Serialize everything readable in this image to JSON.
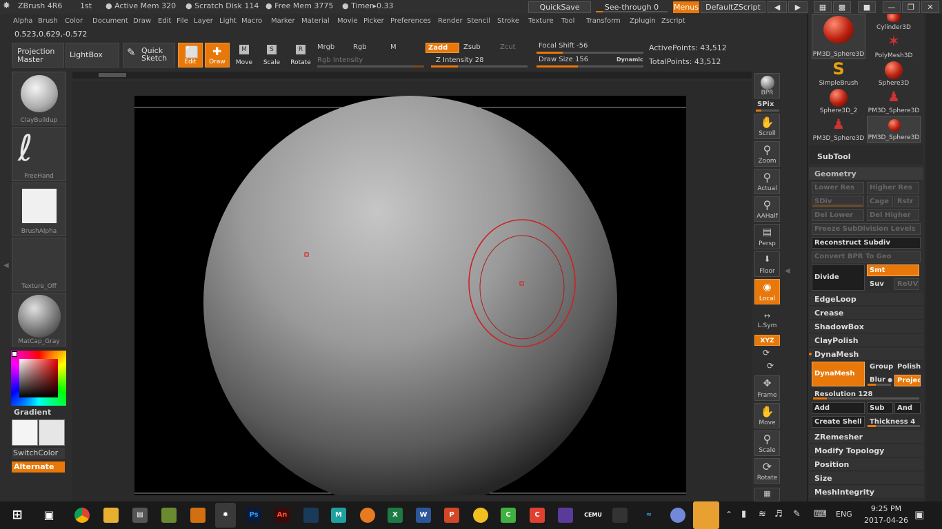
{
  "titlebar": {
    "app": "ZBrush 4R6",
    "doc": "1st",
    "active_mem": "● Active Mem 320",
    "scratch": "● Scratch Disk 114",
    "free_mem": "● Free Mem 3775",
    "timer": "● Timer▸0.33",
    "quicksave": "QuickSave",
    "see_through": "See-through  0",
    "menus": "Menus",
    "zscript": "DefaultZScript"
  },
  "menubar": [
    "Alpha",
    "Brush",
    "Color",
    "Document",
    "Draw",
    "Edit",
    "File",
    "Layer",
    "Light",
    "Macro",
    "Marker",
    "Material",
    "Movie",
    "Picker",
    "Preferences",
    "Render",
    "Stencil",
    "Stroke",
    "Texture",
    "Tool",
    "Transform",
    "Zplugin",
    "Zscript"
  ],
  "coords": "0.523,0.629,-0.572",
  "toolbar": {
    "projection_master": "Projection Master",
    "lightbox": "LightBox",
    "quick_sketch": "Quick Sketch",
    "edit": "Edit",
    "draw": "Draw",
    "move": "Move",
    "scale": "Scale",
    "rotate": "Rotate",
    "mrgb": "Mrgb",
    "rgb": "Rgb",
    "m": "M",
    "zadd": "Zadd",
    "zsub": "Zsub",
    "zcut": "Zcut",
    "rgb_intensity": "Rgb Intensity",
    "z_intensity": "Z Intensity 28",
    "focal_shift": "Focal Shift -56",
    "draw_size": "Draw Size 156",
    "dynamic": "Dynamic",
    "active_points": "ActivePoints: 43,512",
    "total_points": "TotalPoints: 43,512",
    "z_intensity_value": 28,
    "draw_size_value": 156,
    "focal_shift_value": -56
  },
  "left_panel": {
    "brush": "ClayBuildup",
    "stroke": "FreeHand",
    "alpha": "BrushAlpha",
    "texture": "Texture_Off",
    "material": "MatCap_Gray",
    "gradient": "Gradient",
    "switchcolor": "SwitchColor",
    "alternate": "Alternate"
  },
  "right_shelf": {
    "bpr": "BPR",
    "spix": "SPix",
    "scroll": "Scroll",
    "zoom": "Zoom",
    "actual": "Actual",
    "aahalf": "AAHalf",
    "persp": "Persp",
    "floor": "Floor",
    "local": "Local",
    "lsym": "L.Sym",
    "xyz": "XYZ",
    "frame": "Frame",
    "move": "Move",
    "scale": "Scale",
    "rotate": "Rotate",
    "polyf": "PolyF"
  },
  "tools": [
    {
      "name": "PM3D_Sphere3D"
    },
    {
      "name": "Cylinder3D"
    },
    {
      "name": "PolyMesh3D"
    },
    {
      "name": "SimpleBrush"
    },
    {
      "name": "Sphere3D"
    },
    {
      "name": "Sphere3D_2"
    },
    {
      "name": "PM3D_Sphere3D"
    },
    {
      "name": "PM3D_Sphere3D"
    },
    {
      "name": "PM3D_Sphere3D"
    }
  ],
  "subtool": "SubTool",
  "geometry": {
    "title": "Geometry",
    "lower_res": "Lower Res",
    "higher_res": "Higher Res",
    "sdiv": "SDiv",
    "cage": "Cage",
    "rstr": "Rstr",
    "del_lower": "Del Lower",
    "del_higher": "Del Higher",
    "freeze": "Freeze SubDivision Levels",
    "reconstruct": "Reconstruct Subdiv",
    "convert_bpr": "Convert BPR To Geo",
    "divide": "Divide",
    "smt": "Smt",
    "suv": "Suv",
    "reuv": "ReUV",
    "edgeloop": "EdgeLoop",
    "crease": "Crease",
    "shadowbox": "ShadowBox",
    "claypolish": "ClayPolish",
    "dynamesh_header": "DynaMesh",
    "dynamesh_btn": "DynaMesh",
    "group": "Group",
    "polish": "Polish",
    "blur": "Blur",
    "project": "Project",
    "resolution": "Resolution 128",
    "add": "Add",
    "sub": "Sub",
    "and": "And",
    "create_shell": "Create Shell",
    "thickness": "Thickness 4",
    "zremesher": "ZRemesher",
    "modify_topology": "Modify Topology",
    "position": "Position",
    "size": "Size",
    "meshintegrity": "MeshIntegrity"
  },
  "taskbar": {
    "time": "9:25 PM",
    "date": "2017-04-26",
    "lang": "ENG"
  },
  "colors": {
    "accent": "#e8780a",
    "panel": "#2f2f2f",
    "brush_ring": "#cc2222"
  }
}
